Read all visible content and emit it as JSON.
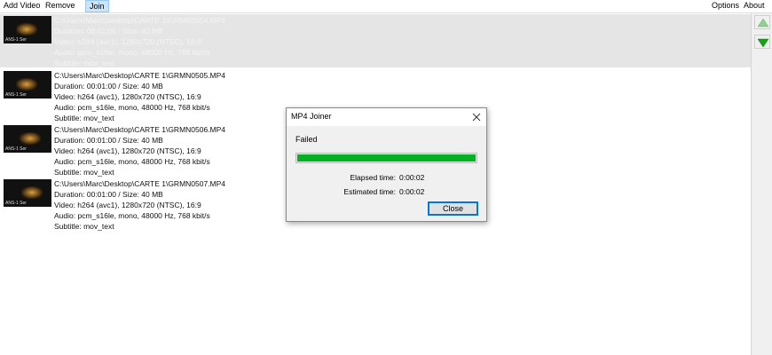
{
  "toolbar": {
    "add_video": "Add Video",
    "remove": "Remove",
    "join": "Join",
    "options": "Options",
    "about": "About"
  },
  "files": [
    {
      "path": "C:\\Users\\Marc\\Desktop\\CARTE 1\\GRMN0504.MP4",
      "duration": "Duration: 00:01:00 / Size: 40 MB",
      "video": "Video: h264 (avc1), 1280x720 (NTSC), 16:9",
      "audio": "Audio: pcm_s16le, mono, 48000 Hz, 768 kbit/s",
      "subtitle": "Subtitle: mov_text",
      "selected": true
    },
    {
      "path": "C:\\Users\\Marc\\Desktop\\CARTE 1\\GRMN0505.MP4",
      "duration": "Duration: 00:01:00 / Size: 40 MB",
      "video": "Video: h264 (avc1), 1280x720 (NTSC), 16:9",
      "audio": "Audio: pcm_s16le, mono, 48000 Hz, 768 kbit/s",
      "subtitle": "Subtitle: mov_text",
      "selected": false
    },
    {
      "path": "C:\\Users\\Marc\\Desktop\\CARTE 1\\GRMN0506.MP4",
      "duration": "Duration: 00:01:00 / Size: 40 MB",
      "video": "Video: h264 (avc1), 1280x720 (NTSC), 16:9",
      "audio": "Audio: pcm_s16le, mono, 48000 Hz, 768 kbit/s",
      "subtitle": "Subtitle: mov_text",
      "selected": false
    },
    {
      "path": "C:\\Users\\Marc\\Desktop\\CARTE 1\\GRMN0507.MP4",
      "duration": "Duration: 00:01:00 / Size: 40 MB",
      "video": "Video: h264 (avc1), 1280x720 (NTSC), 16:9",
      "audio": "Audio: pcm_s16le, mono, 48000 Hz, 768 kbit/s",
      "subtitle": "Subtitle: mov_text",
      "selected": false
    }
  ],
  "side_buttons": {
    "move_up_icon": "arrow-up-icon",
    "move_down_icon": "arrow-down-icon"
  },
  "dialog": {
    "title": "MP4 Joiner",
    "status": "Failed",
    "progress": 1.0,
    "elapsed_label": "Elapsed time:",
    "elapsed_value": "0:00:02",
    "estimated_label": "Estimated time:",
    "estimated_value": "0:00:02",
    "close_button": "Close"
  },
  "colors": {
    "progress": "#06b025",
    "selection": "#e5e5e5",
    "active_toolbar": "#cce4f7",
    "arrow_green": "#1aa11a"
  }
}
